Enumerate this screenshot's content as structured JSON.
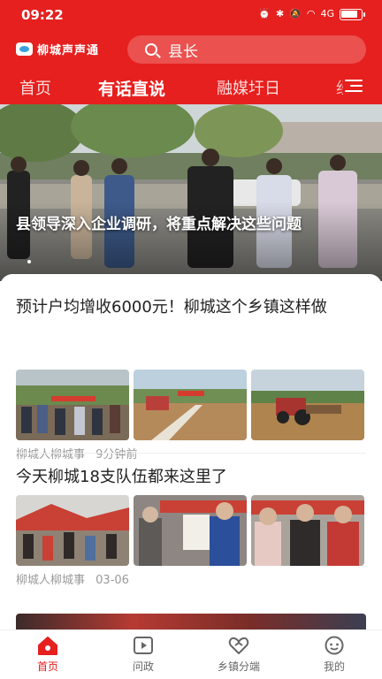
{
  "status_bar": {
    "time": "09:22",
    "icons": [
      "alarm-icon",
      "bluetooth-icon",
      "mute-icon",
      "wifi-icon",
      "signal-icon",
      "battery-icon"
    ],
    "signal_text": "4G"
  },
  "header": {
    "app_name": "柳城声声通",
    "search_placeholder": "县长"
  },
  "tabs": [
    {
      "label": "首页",
      "active": false
    },
    {
      "label": "有话直说",
      "active": true
    },
    {
      "label": "融媒圩日",
      "active": false
    },
    {
      "label": "经",
      "active": false
    }
  ],
  "hero": {
    "title": "县领导深入企业调研，将重点解决这些问题"
  },
  "feed": {
    "articles": [
      {
        "title": "预计户均增收6000元！柳城这个乡镇这样做",
        "source": "柳城人柳城事",
        "time": "9分钟前"
      },
      {
        "title": "今天柳城18支队伍都来这里了",
        "source": "柳城人柳城事",
        "time": "03-06"
      }
    ]
  },
  "bottom_nav": [
    {
      "label": "首页",
      "icon": "home-icon",
      "active": true
    },
    {
      "label": "问政",
      "icon": "video-icon",
      "active": false
    },
    {
      "label": "乡镇分端",
      "icon": "heart-icon",
      "active": false
    },
    {
      "label": "我的",
      "icon": "profile-icon",
      "active": false
    }
  ],
  "colors": {
    "brand_red": "#e5201e",
    "meta_gray": "#9a9a9a",
    "title_text": "#222222"
  }
}
